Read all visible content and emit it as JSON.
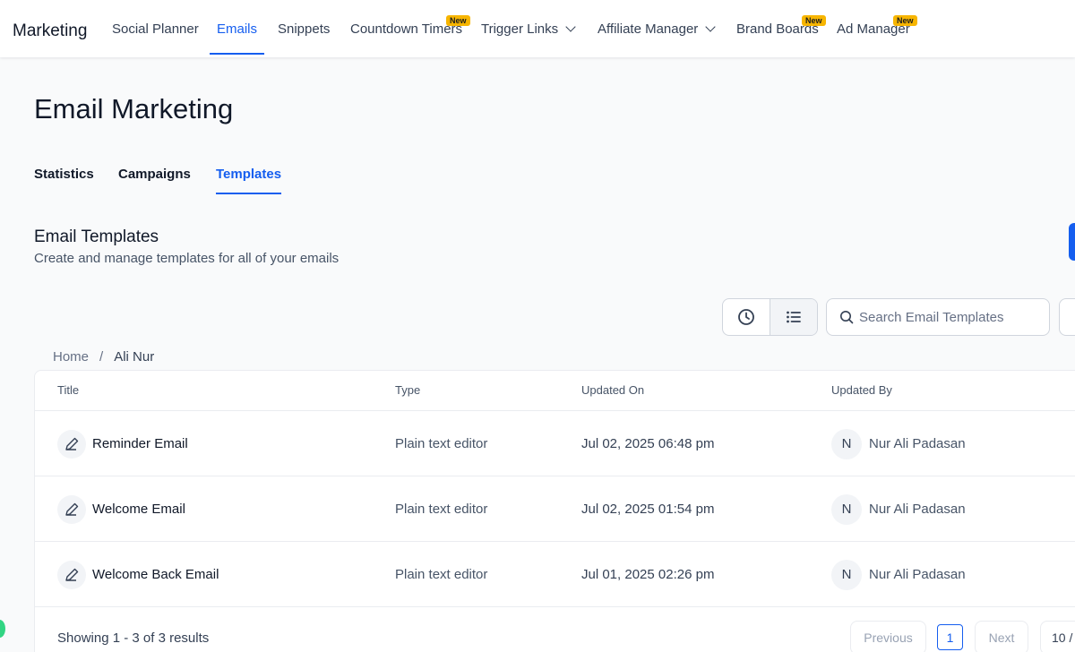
{
  "nav": {
    "brand": "Marketing",
    "items": [
      {
        "label": "Social Planner"
      },
      {
        "label": "Emails"
      },
      {
        "label": "Snippets"
      },
      {
        "label": "Countdown Timers",
        "badge": "New"
      },
      {
        "label": "Trigger Links"
      },
      {
        "label": "Affiliate Manager"
      },
      {
        "label": "Brand Boards",
        "badge": "New"
      },
      {
        "label": "Ad Manager",
        "badge": "New"
      }
    ]
  },
  "page": {
    "title": "Email Marketing"
  },
  "tabs": [
    {
      "label": "Statistics"
    },
    {
      "label": "Campaigns"
    },
    {
      "label": "Templates"
    }
  ],
  "section": {
    "title": "Email Templates",
    "subtitle": "Create and manage templates for all of your emails"
  },
  "search": {
    "placeholder": "Search Email Templates"
  },
  "breadcrumb": {
    "home": "Home",
    "separator": "/",
    "current": "Ali Nur"
  },
  "table": {
    "columns": [
      "Title",
      "Type",
      "Updated On",
      "Updated By"
    ],
    "rows": [
      {
        "title": "Reminder Email",
        "type": "Plain text editor",
        "updated_on": "Jul 02, 2025 06:48 pm",
        "avatar": "N",
        "updated_by": "Nur Ali Padasan"
      },
      {
        "title": "Welcome Email",
        "type": "Plain text editor",
        "updated_on": "Jul 02, 2025 01:54 pm",
        "avatar": "N",
        "updated_by": "Nur Ali Padasan"
      },
      {
        "title": "Welcome Back Email",
        "type": "Plain text editor",
        "updated_on": "Jul 01, 2025 02:26 pm",
        "avatar": "N",
        "updated_by": "Nur Ali Padasan"
      }
    ]
  },
  "pagination": {
    "showing": "Showing 1 - 3 of 3 results",
    "previous": "Previous",
    "current_page": "1",
    "next": "Next",
    "page_size": "10 /"
  },
  "colors": {
    "accent": "#155eef",
    "badge": "#f7b500"
  }
}
